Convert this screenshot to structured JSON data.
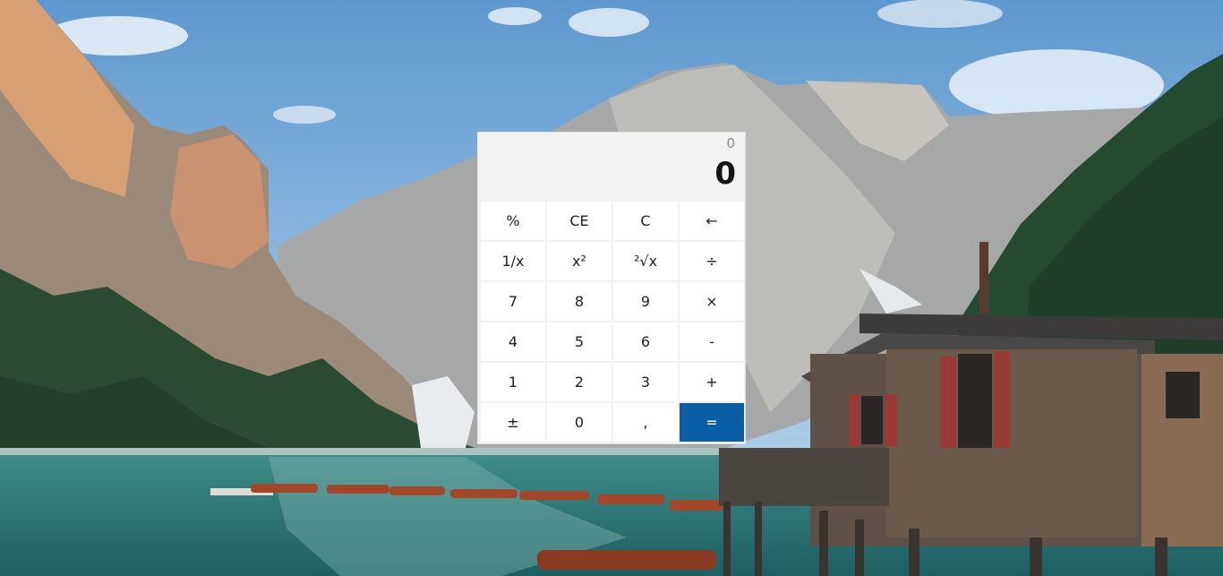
{
  "colors": {
    "sky": "#7fb0d8",
    "panel": "#f2f2f2",
    "key": "#ffffff",
    "equals_key": "#0b5ea6"
  },
  "background": {
    "description_icon": "mountain-lake-wallpaper"
  },
  "calculator": {
    "expression": "0",
    "result": "0",
    "keys": [
      {
        "name": "percent-button",
        "label": "%"
      },
      {
        "name": "clear-entry-button",
        "label": "CE"
      },
      {
        "name": "clear-button",
        "label": "C"
      },
      {
        "name": "backspace-button",
        "label": "←"
      },
      {
        "name": "reciprocal-button",
        "label": "1/x"
      },
      {
        "name": "square-button",
        "label": "x²"
      },
      {
        "name": "square-root-button",
        "label": "²√x"
      },
      {
        "name": "divide-button",
        "label": "÷"
      },
      {
        "name": "digit-7-button",
        "label": "7"
      },
      {
        "name": "digit-8-button",
        "label": "8"
      },
      {
        "name": "digit-9-button",
        "label": "9"
      },
      {
        "name": "multiply-button",
        "label": "×"
      },
      {
        "name": "digit-4-button",
        "label": "4"
      },
      {
        "name": "digit-5-button",
        "label": "5"
      },
      {
        "name": "digit-6-button",
        "label": "6"
      },
      {
        "name": "subtract-button",
        "label": "-"
      },
      {
        "name": "digit-1-button",
        "label": "1"
      },
      {
        "name": "digit-2-button",
        "label": "2"
      },
      {
        "name": "digit-3-button",
        "label": "3"
      },
      {
        "name": "add-button",
        "label": "+"
      },
      {
        "name": "negate-button",
        "label": "±"
      },
      {
        "name": "digit-0-button",
        "label": "0"
      },
      {
        "name": "decimal-button",
        "label": ","
      },
      {
        "name": "equals-button",
        "label": "="
      }
    ]
  }
}
